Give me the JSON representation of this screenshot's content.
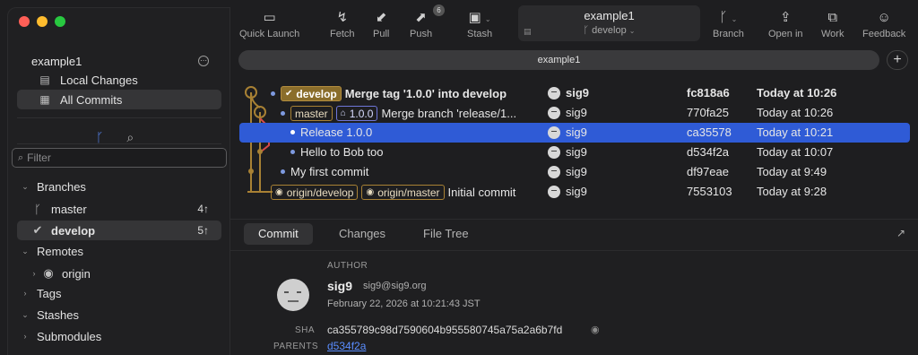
{
  "sidebar": {
    "repo_name": "example1",
    "nav": [
      {
        "label": "Local Changes",
        "icon": "file-icon"
      },
      {
        "label": "All Commits",
        "icon": "archive-icon"
      }
    ],
    "filter_placeholder": "Filter",
    "sections": {
      "branches": "Branches",
      "remotes": "Remotes",
      "tags": "Tags",
      "stashes": "Stashes",
      "submodules": "Submodules"
    },
    "branches": [
      {
        "name": "master",
        "count": "4↑"
      },
      {
        "name": "develop",
        "count": "5↑"
      }
    ],
    "remotes": [
      {
        "name": "origin"
      }
    ]
  },
  "toolbar": {
    "quick_launch": "Quick Launch",
    "fetch": "Fetch",
    "pull": "Pull",
    "push": "Push",
    "push_badge": "6",
    "stash": "Stash",
    "repo_title": "example1",
    "branch_name": "develop",
    "branch": "Branch",
    "open_in": "Open in",
    "work": "Work",
    "feedback": "Feedback"
  },
  "tabbar": {
    "title": "example1",
    "add": "+"
  },
  "commits": [
    {
      "refs": [
        {
          "label": "develop",
          "kind": "head"
        }
      ],
      "message": "Merge tag '1.0.0' into develop",
      "author": "sig9",
      "sha": "fc818a6",
      "date": "Today at 10:26",
      "bold": true,
      "selected": false
    },
    {
      "refs": [
        {
          "label": "master",
          "kind": "branch"
        },
        {
          "label": "1.0.0",
          "kind": "tag"
        }
      ],
      "message": "Merge branch 'release/1...",
      "author": "sig9",
      "sha": "770fa25",
      "date": "Today at 10:26",
      "bold": false,
      "selected": false
    },
    {
      "refs": [],
      "message": "Release 1.0.0",
      "author": "sig9",
      "sha": "ca35578",
      "date": "Today at 10:21",
      "bold": false,
      "selected": true
    },
    {
      "refs": [],
      "message": "Hello to Bob too",
      "author": "sig9",
      "sha": "d534f2a",
      "date": "Today at 10:07",
      "bold": false,
      "selected": false
    },
    {
      "refs": [],
      "message": "My first commit",
      "author": "sig9",
      "sha": "df97eae",
      "date": "Today at 9:49",
      "bold": false,
      "selected": false
    },
    {
      "refs": [
        {
          "label": "origin/develop",
          "kind": "remote"
        },
        {
          "label": "origin/master",
          "kind": "remote"
        }
      ],
      "message": "Initial commit",
      "author": "sig9",
      "sha": "7553103",
      "date": "Today at 9:28",
      "bold": false,
      "selected": false
    }
  ],
  "details": {
    "tabs": [
      "Commit",
      "Changes",
      "File Tree"
    ],
    "author_label": "AUTHOR",
    "author_name": "sig9",
    "author_email": "sig9@sig9.org",
    "author_date": "February 22, 2026 at 10:21:43 JST",
    "sha_label": "SHA",
    "sha": "ca355789c98d7590604b955580745a75a2a6b7fd",
    "parents_label": "PARENTS",
    "parent": "d534f2a"
  },
  "colors": {
    "selection": "#2f5bd6",
    "accent": "#5a8dff",
    "ref_head": "#8a6d2b"
  }
}
